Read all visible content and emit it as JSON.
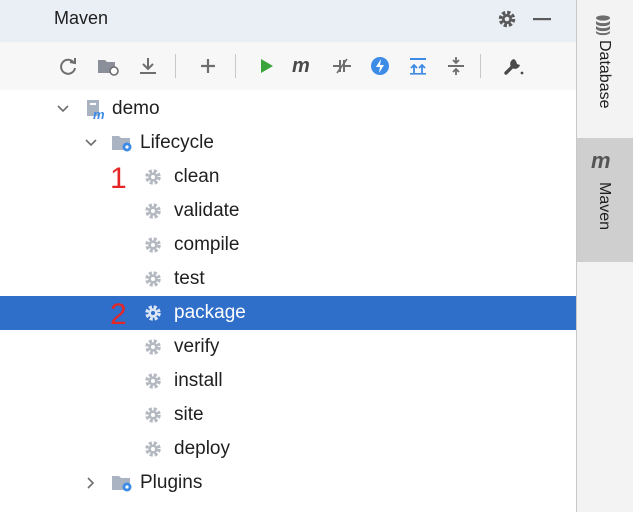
{
  "panel": {
    "title": "Maven",
    "gear_icon": "gear-icon",
    "minimize_icon": "minimize-icon"
  },
  "toolbar": {
    "buttons": [
      {
        "name": "reload-all-projects-button",
        "icon": "reload-icon"
      },
      {
        "name": "generate-sources-button",
        "icon": "folder-reload-icon"
      },
      {
        "name": "download-sources-button",
        "icon": "download-icon"
      },
      {
        "name": "add-maven-project-button",
        "icon": "plus-icon"
      },
      {
        "name": "run-maven-build-button",
        "icon": "run-icon"
      },
      {
        "name": "execute-maven-goal-button",
        "icon": "maven-m-icon"
      },
      {
        "name": "toggle-offline-mode-button",
        "icon": "offline-icon"
      },
      {
        "name": "skip-tests-button",
        "icon": "lightning-icon"
      },
      {
        "name": "show-dependencies-button",
        "icon": "expand-all-icon"
      },
      {
        "name": "collapse-all-button",
        "icon": "collapse-all-icon"
      },
      {
        "name": "maven-settings-button",
        "icon": "wrench-icon"
      }
    ]
  },
  "tree": {
    "project": "demo",
    "lifecycle": "Lifecycle",
    "goals": [
      "clean",
      "validate",
      "compile",
      "test",
      "package",
      "verify",
      "install",
      "site",
      "deploy"
    ],
    "plugins": "Plugins",
    "selected_goal": "package",
    "annotation_1": "1",
    "annotation_2": "2"
  },
  "sidebar": {
    "database_label": "Database",
    "maven_label": "Maven",
    "maven_icon_letter": "m"
  },
  "colors": {
    "selection": "#2f6ec9",
    "annotation": "#e62626",
    "run_green": "#3aa43a",
    "lightning_blue": "#3d8be6"
  }
}
